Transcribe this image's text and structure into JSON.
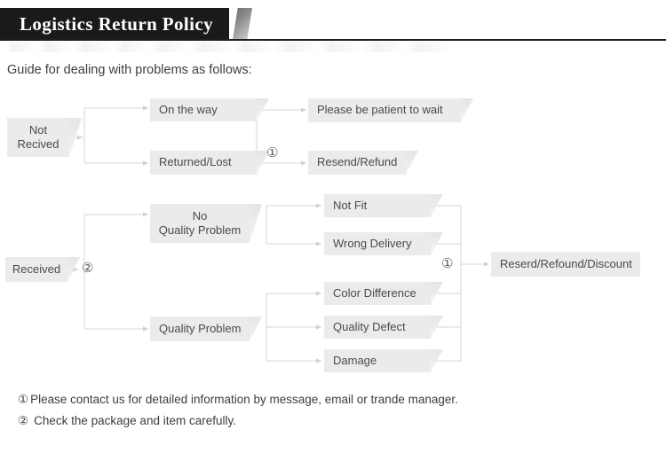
{
  "header": {
    "title": "Logistics Return Policy",
    "arrow_icon": "banner-arrow-icon"
  },
  "intro": "Guide for dealing with problems as follows:",
  "diagram": {
    "type": "flowchart",
    "branch_not_received": {
      "root": "Not\nRecived",
      "root_line1": "Not",
      "root_line2": "Recived",
      "stages": [
        "On the way",
        "Returned/Lost"
      ],
      "outcomes": [
        "Please be patient to wait",
        "Resend/Refund"
      ],
      "marker": "①"
    },
    "branch_received": {
      "root": "Received",
      "marker": "②",
      "categories": [
        {
          "label_line1": "No",
          "label_line2": "Quality Problem",
          "issues": [
            "Not Fit",
            "Wrong Delivery"
          ]
        },
        {
          "label_line1": "Quality Problem",
          "label_line2": "",
          "issues": [
            "Color Difference",
            "Quality Defect",
            "Damage"
          ]
        }
      ],
      "outcome": "Reserd/Refound/Discount",
      "outcome_marker": "①"
    }
  },
  "notes": [
    {
      "num": "①",
      "text": "Please contact us for detailed information by message, email or trande manager."
    },
    {
      "num": "②",
      "text": "Check the package and item carefully."
    }
  ],
  "colors": {
    "banner_bg": "#1a1a1a",
    "node_bg": "#ebebeb",
    "wire": "#d2d2d2",
    "text": "#4a4a4a"
  }
}
